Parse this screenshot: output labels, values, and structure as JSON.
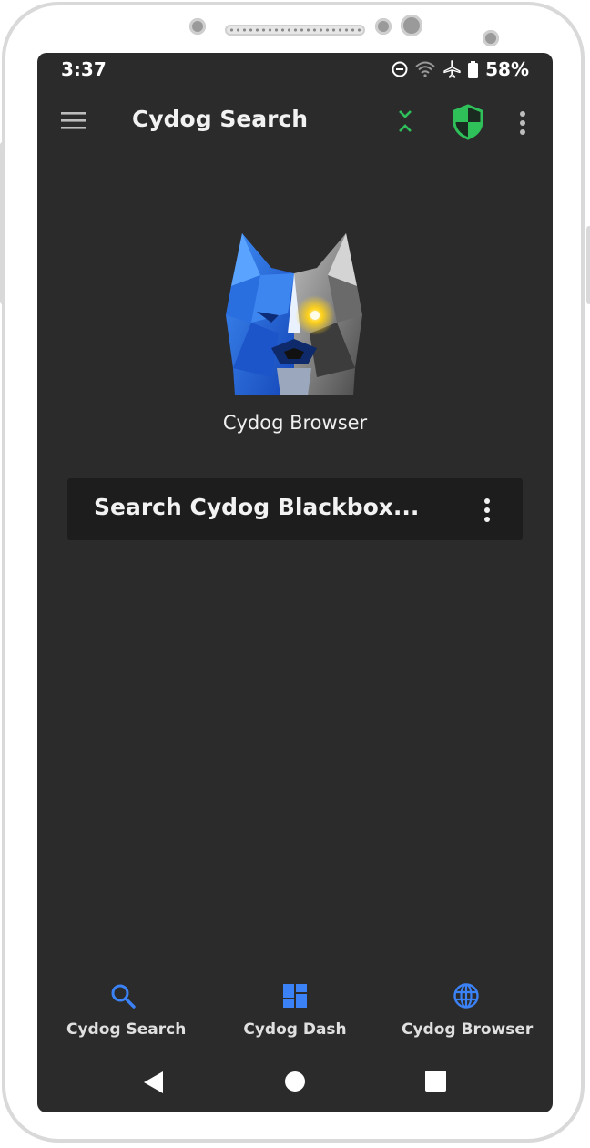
{
  "status": {
    "time": "3:37",
    "battery": "58%",
    "icons": [
      "do-not-disturb-icon",
      "wifi-icon",
      "airplane-mode-icon",
      "battery-icon"
    ]
  },
  "appbar": {
    "title": "Cydog Search",
    "icons": [
      "menu-icon",
      "collapse-icon",
      "shield-icon",
      "more-vert-icon"
    ]
  },
  "logo": {
    "caption": "Cydog Browser"
  },
  "search": {
    "placeholder": "Search Cydog Blackbox..."
  },
  "bottom_nav": {
    "items": [
      {
        "label": "Cydog Search",
        "icon": "search-icon"
      },
      {
        "label": "Cydog Dash",
        "icon": "dashboard-icon"
      },
      {
        "label": "Cydog Browser",
        "icon": "globe-icon"
      }
    ]
  },
  "system_nav": [
    "back-icon",
    "home-icon",
    "recents-icon"
  ],
  "colors": {
    "background": "#2b2b2b",
    "search_bar": "#1d1d1d",
    "accent_green": "#2fc05a",
    "accent_blue": "#3b82f6"
  }
}
